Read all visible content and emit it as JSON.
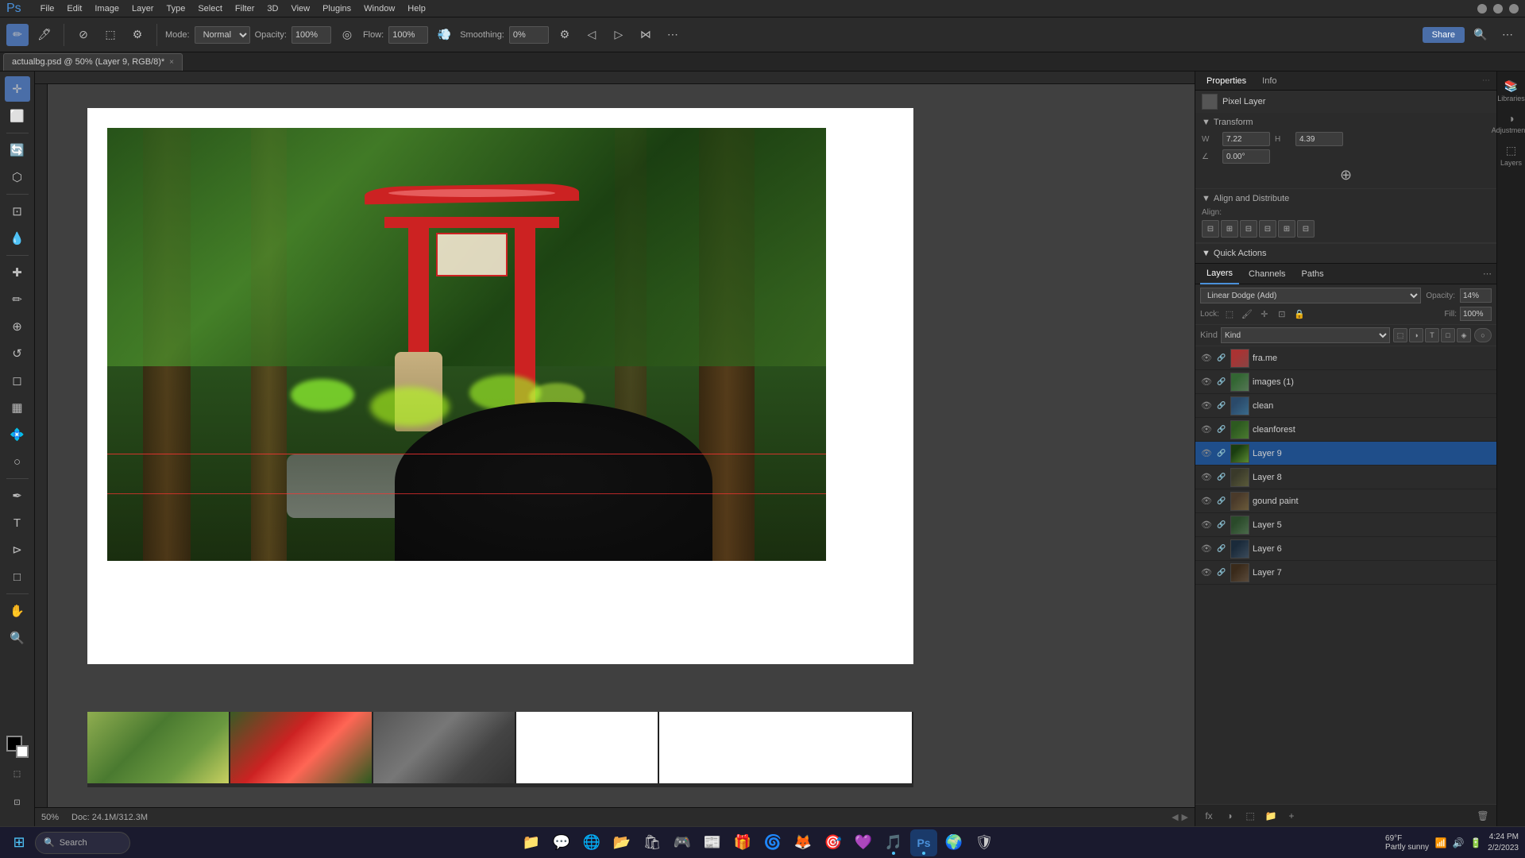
{
  "app": {
    "title": "actualbg.psd @ 50% (Layer 9, RGB/8)*",
    "zoom": "50%"
  },
  "menubar": {
    "items": [
      "File",
      "Edit",
      "Image",
      "Layer",
      "Type",
      "Select",
      "Filter",
      "3D",
      "View",
      "Plugins",
      "Window",
      "Help"
    ]
  },
  "toolbar": {
    "mode_label": "Mode:",
    "mode_value": "Normal",
    "opacity_label": "Opacity:",
    "opacity_value": "100%",
    "flow_label": "Flow:",
    "flow_value": "100%",
    "smoothing_label": "Smoothing:",
    "smoothing_value": "0%"
  },
  "tab": {
    "label": "actualbg.psd @ 50% (Layer 9, RGB/8)*",
    "close": "×"
  },
  "properties": {
    "tabs": [
      "Properties",
      "Info"
    ],
    "pixel_layer_label": "Pixel Layer",
    "transform_label": "Transform",
    "w_label": "W",
    "w_value": "7.22",
    "h_label": "H",
    "h_value": "4.39",
    "angle_label": "∠",
    "angle_value": "0.00°",
    "align_label": "Align and Distribute",
    "align_placeholder": "Align:"
  },
  "quick_actions": {
    "title": "Quick Actions"
  },
  "layers": {
    "panel_title": "Layers",
    "channels_label": "Channels",
    "paths_label": "Paths",
    "blend_mode": "Linear Dodge (Add)",
    "opacity_label": "Opacity:",
    "opacity_value": "14%",
    "fill_label": "Fill:",
    "fill_value": "100%",
    "lock_label": "Lock:",
    "search_kind": "Kind",
    "items": [
      {
        "name": "fra.me",
        "visible": true,
        "linked": false,
        "thumb_class": "lt-frame"
      },
      {
        "name": "images (1)",
        "visible": true,
        "linked": false,
        "thumb_class": "lt-images"
      },
      {
        "name": "clean",
        "visible": true,
        "linked": false,
        "thumb_class": "lt-clean"
      },
      {
        "name": "cleanforest",
        "visible": true,
        "linked": false,
        "thumb_class": "lt-cleanforest"
      },
      {
        "name": "Layer 9",
        "visible": true,
        "linked": false,
        "thumb_class": "lt-layer9",
        "selected": true
      },
      {
        "name": "Layer 8",
        "visible": true,
        "linked": false,
        "thumb_class": "lt-layer8"
      },
      {
        "name": "gound paint",
        "visible": true,
        "linked": false,
        "thumb_class": "lt-gound"
      },
      {
        "name": "Layer 5",
        "visible": true,
        "linked": false,
        "thumb_class": "lt-layer5"
      },
      {
        "name": "Layer 6",
        "visible": true,
        "linked": false,
        "thumb_class": "lt-layer6"
      },
      {
        "name": "Layer 7",
        "visible": true,
        "linked": false,
        "thumb_class": "lt-layer7"
      }
    ],
    "bottom_icons": [
      "fx",
      "Ω",
      "□",
      "📁",
      "🎨",
      "🗑"
    ]
  },
  "side_panel": {
    "libraries_label": "Libraries",
    "adjustments_label": "Adjustments",
    "layers_label": "Layers"
  },
  "status": {
    "zoom": "50%",
    "doc_size": "Doc: 24.1M/312.3M"
  },
  "taskbar": {
    "search_label": "Search",
    "time": "4:24 PM",
    "date": "2/2/2023",
    "weather_temp": "69°F",
    "weather_desc": "Partly sunny",
    "apps": [
      "⊞",
      "🔍",
      "📁",
      "💬",
      "🌐",
      "📁",
      "🛍",
      "🎮",
      "📰",
      "🎁",
      "🌀",
      "🦊",
      "🎯",
      "💜",
      "🎵",
      "Ps",
      "🌍",
      "🛡"
    ]
  }
}
